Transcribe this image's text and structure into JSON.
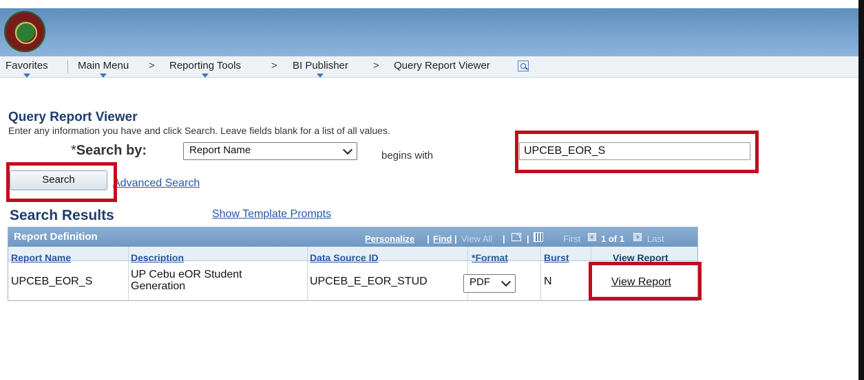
{
  "navbar": {
    "favorites": "Favorites",
    "main_menu": "Main Menu",
    "reporting_tools": "Reporting Tools",
    "bi_publisher": "BI Publisher",
    "query_report_viewer": "Query Report Viewer",
    "arrow": ">"
  },
  "page": {
    "title": "Query Report Viewer",
    "instructions": "Enter any information you have and click Search. Leave fields blank for a list of all values.",
    "required_marker": "*",
    "search_by_label": "Search by:",
    "search_by_value": "Report Name",
    "operator": "begins with",
    "search_value": "UPCEB_EOR_S",
    "search_button": "Search",
    "advanced_search": "Advanced Search",
    "results_title": "Search Results",
    "show_template_prompts": "Show Template Prompts"
  },
  "grid": {
    "title": "Report Definition",
    "personalize": "Personalize",
    "find": "Find",
    "view_all": "View All",
    "pipe": "|",
    "first": "First",
    "count": "1 of 1",
    "last": "Last",
    "columns": [
      "Report Name",
      "Description",
      "Data Source ID",
      "*Format",
      "Burst",
      "View Report"
    ],
    "rows": [
      {
        "report_name": "UPCEB_EOR_S",
        "description": "UP Cebu eOR Student Generation",
        "data_source_id": "UPCEB_E_EOR_STUD",
        "format": "PDF",
        "burst": "N",
        "view_report": "View Report"
      }
    ]
  },
  "colors": {
    "header_blue": "#7aa6d1",
    "link_blue": "#2557a2",
    "highlight_red": "#c00d1e",
    "title_blue": "#1c3d6b"
  },
  "icons": [
    "university-seal-logo",
    "query-report-viewer-icon",
    "zoom-icon",
    "download-excel-icon",
    "previous-arrow-icon",
    "next-arrow-icon"
  ]
}
